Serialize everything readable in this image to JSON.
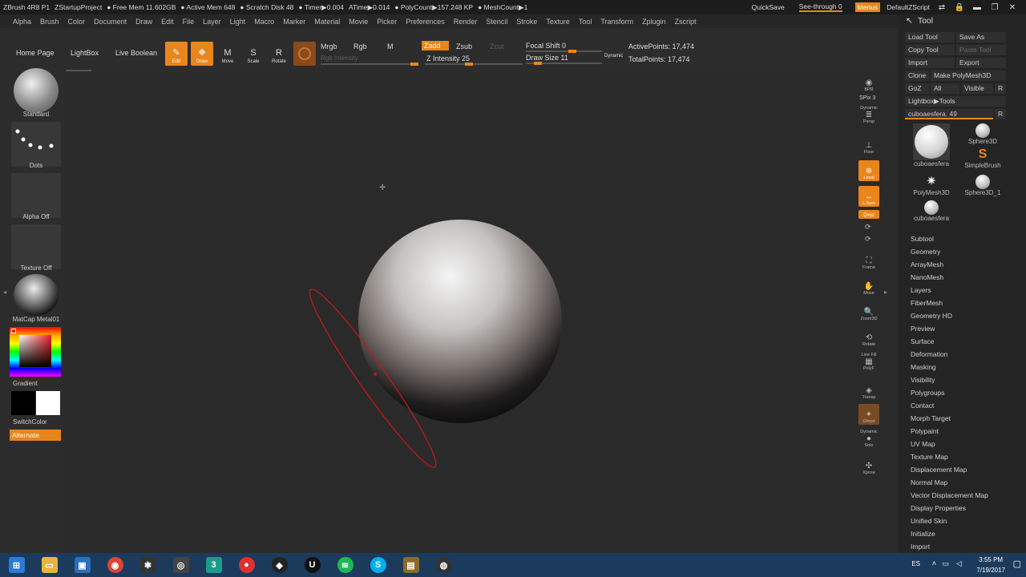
{
  "titlebar": {
    "app": "ZBrush 4R8 P1",
    "project": "ZStartupProject",
    "free_mem": "● Free Mem 11.602GB",
    "active_mem": "● Active Mem 648",
    "scratch": "● Scratch Disk 48",
    "timer": "● Timer▶0.004",
    "atime": "ATime▶0.014",
    "polycount": "● PolyCount▶157.248 KP",
    "meshcount": "● MeshCount▶1",
    "quicksave": "QuickSave",
    "seethrough": "See-through  0",
    "menus": "Menus",
    "script": "DefaultZScript"
  },
  "menubar": {
    "items": [
      "Alpha",
      "Brush",
      "Color",
      "Document",
      "Draw",
      "Edit",
      "File",
      "Layer",
      "Light",
      "Macro",
      "Marker",
      "Material",
      "Movie",
      "Picker",
      "Preferences",
      "Render",
      "Stencil",
      "Stroke",
      "Texture",
      "Tool",
      "Transform",
      "Zplugin",
      "Zscript"
    ]
  },
  "toolbar": {
    "home_page": "Home Page",
    "lightbox": "LightBox",
    "live_boolean": "Live Boolean",
    "edit": "Edit",
    "draw": "Draw",
    "move": "Move",
    "scale": "Scale",
    "rotate": "Rotate",
    "mrgb": "Mrgb",
    "rgb": "Rgb",
    "m": "M",
    "rgb_intensity": "Rgb Intensity",
    "zadd": "Zadd",
    "zsub": "Zsub",
    "zcut": "Zcut",
    "z_intensity": "Z Intensity 25",
    "z_intensity_value": 25,
    "focal_shift": "Focal Shift 0",
    "draw_size": "Draw Size 11",
    "dynamic": "Dynamic",
    "active_points": "ActivePoints: 17,474",
    "total_points": "TotalPoints: 17,474"
  },
  "leftshelf": {
    "brush": "Standard",
    "stroke": "Dots",
    "alpha": "Alpha Off",
    "texture": "Texture Off",
    "material": "MatCap Metal01",
    "gradient": "Gradient",
    "switchcolor": "SwitchColor",
    "alternate": "Alternate"
  },
  "rightshelf": {
    "bpr": "BPR",
    "spix": "SPix 3",
    "dynamic": "Dynamic",
    "persp": "Persp",
    "floor": "Floor",
    "local": "Local",
    "lsym": "L.Sym",
    "xyz": "Qxyz",
    "frame": "Frame",
    "move": "Move",
    "zoom3d": "Zoom3D",
    "rotate": "Rotate",
    "linefill": "Line Fill",
    "polyf": "PolyF",
    "transp": "Transp",
    "ghost": "Ghost",
    "solo": "Solo",
    "xpose": "Xpose"
  },
  "toolpanel": {
    "title": "Tool",
    "load_tool": "Load Tool",
    "save_as": "Save As",
    "copy_tool": "Copy Tool",
    "paste_tool": "Paste Tool",
    "import": "Import",
    "export": "Export",
    "clone": "Clone",
    "make_polymesh": "Make PolyMesh3D",
    "goz": "GoZ",
    "all": "All",
    "visible": "Visible",
    "r": "R",
    "lightbox_tools": "Lightbox▶Tools",
    "current_tool": "cuboaesfera. 49",
    "tools": [
      {
        "name": "cuboaesfera"
      },
      {
        "name": "Sphere3D"
      },
      {
        "name": "SimpleBrush"
      },
      {
        "name": "PolyMesh3D"
      },
      {
        "name": "Sphere3D_1"
      },
      {
        "name": "cuboaesfera"
      }
    ],
    "subpalettes": [
      "Subtool",
      "Geometry",
      "ArrayMesh",
      "NanoMesh",
      "Layers",
      "FiberMesh",
      "Geometry HD",
      "Preview",
      "Surface",
      "Deformation",
      "Masking",
      "Visibility",
      "Polygroups",
      "Contact",
      "Morph Target",
      "Polypaint",
      "UV Map",
      "Texture Map",
      "Displacement Map",
      "Normal Map",
      "Vector Displacement Map",
      "Display Properties",
      "Unified Skin",
      "Initialize",
      "Import"
    ]
  },
  "taskbar": {
    "time": "3:55 PM",
    "date": "7/19/2017",
    "lang": "ES"
  },
  "colors": {
    "accent": "#e8861c",
    "panel": "#2c2c2c",
    "taskbar": "#1b3a5c"
  }
}
